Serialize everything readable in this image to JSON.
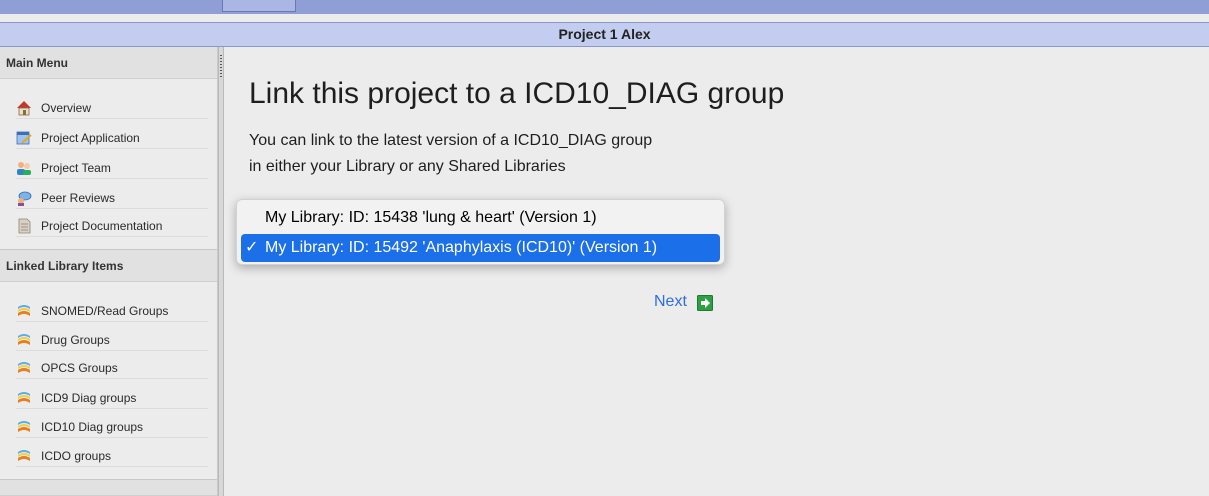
{
  "project_title": "Project 1 Alex",
  "sidebar": {
    "main_menu_title": "Main Menu",
    "main_menu": [
      {
        "label": "Overview",
        "icon": "house-icon"
      },
      {
        "label": "Project Application",
        "icon": "application-edit-icon"
      },
      {
        "label": "Project Team",
        "icon": "team-icon"
      },
      {
        "label": "Peer Reviews",
        "icon": "peer-review-icon"
      },
      {
        "label": "Project Documentation",
        "icon": "document-icon"
      }
    ],
    "linked_title": "Linked Library Items",
    "linked_items": [
      {
        "label": "SNOMED/Read Groups",
        "icon": "group-stack-icon"
      },
      {
        "label": "Drug Groups",
        "icon": "group-stack-icon"
      },
      {
        "label": "OPCS Groups",
        "icon": "group-stack-icon"
      },
      {
        "label": "ICD9 Diag groups",
        "icon": "group-stack-icon"
      },
      {
        "label": "ICD10 Diag groups",
        "icon": "group-stack-icon"
      },
      {
        "label": "ICDO groups",
        "icon": "group-stack-icon"
      }
    ]
  },
  "main": {
    "heading": "Link this project to a ICD10_DIAG group",
    "description_line1": "You can link to the latest version of a ICD10_DIAG group",
    "description_line2": "in either your Library or any Shared Libraries",
    "dropdown": {
      "options": [
        {
          "label": "My Library: ID: 15438 'lung & heart' (Version 1)",
          "selected": false
        },
        {
          "label": "My Library: ID: 15492 'Anaphylaxis (ICD10)' (Version 1)",
          "selected": true
        }
      ],
      "check_mark": "✓"
    },
    "next_label": "Next"
  },
  "colors": {
    "title_bar": "#c3cdf0",
    "top_strip": "#8f9fd6",
    "selected_option": "#1b6fe8",
    "link": "#2c6ee0"
  }
}
